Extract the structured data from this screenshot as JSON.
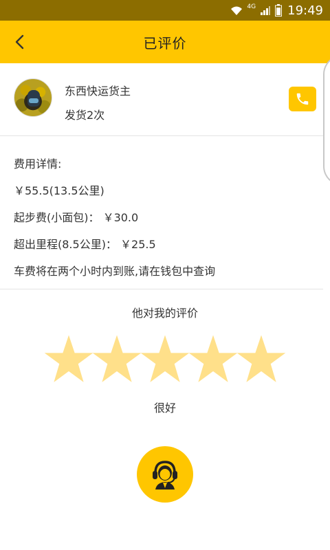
{
  "statusbar": {
    "time": "19:49",
    "network_label": "4G",
    "icons": [
      "wifi-icon",
      "cell-signal-icon",
      "battery-icon"
    ]
  },
  "appbar": {
    "title": "已评价",
    "back_icon": "chevron-left-icon",
    "background": "#ffc600"
  },
  "profile": {
    "name": "东西快运货主",
    "shipments": "发货2次",
    "call_icon": "phone-icon"
  },
  "fees": {
    "heading": "费用详情:",
    "total": "￥55.5(13.5公里)",
    "base_fee": "起步费(小面包)： ￥30.0",
    "extra_mileage": "超出里程(8.5公里)： ￥25.5",
    "note": "车费将在两个小时内到账,请在钱包中查询"
  },
  "rating": {
    "title": "他对我的评价",
    "stars_filled": 5,
    "stars_total": 5,
    "star_color": "#ffe08a",
    "label": "很好"
  },
  "support": {
    "icon": "customer-service-icon"
  }
}
